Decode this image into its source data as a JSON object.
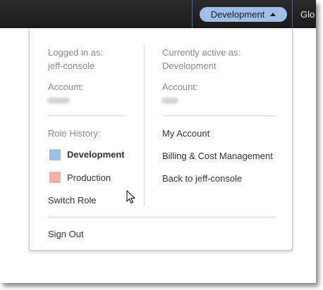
{
  "topbar": {
    "role_label": "Development",
    "next_menu_label": "Glo",
    "role_color": "#a0bfe6"
  },
  "menu": {
    "left": {
      "logged_in_label": "Logged in as:",
      "logged_in_value": "jeff-console",
      "account_label": "Account:",
      "role_history_label": "Role History:",
      "roles": [
        {
          "name": "Development",
          "color": "#a0bfe6",
          "active": true
        },
        {
          "name": "Production",
          "color": "#f3b0aa",
          "active": false
        }
      ],
      "switch_role_label": "Switch Role"
    },
    "right": {
      "active_label": "Currently active as:",
      "active_value": "Development",
      "account_label": "Account:",
      "links": [
        "My Account",
        "Billing & Cost Management",
        "Back to jeff-console"
      ]
    },
    "sign_out_label": "Sign Out"
  },
  "icons": {
    "role_chevron": "chevron-up-icon",
    "pointer": "mouse-pointer-icon"
  }
}
